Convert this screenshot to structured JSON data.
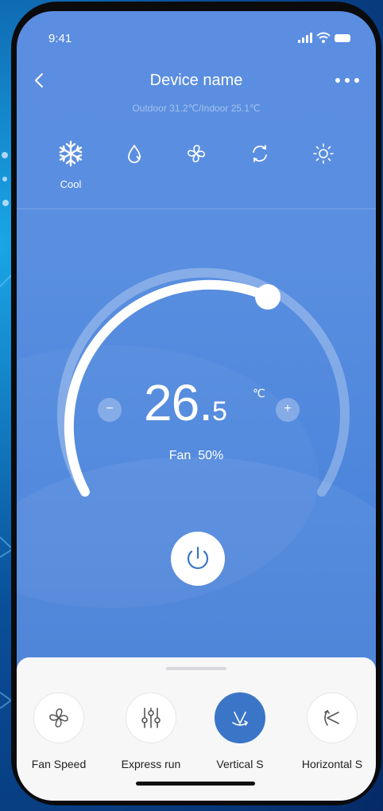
{
  "status": {
    "time": "9:41"
  },
  "header": {
    "title": "Device name",
    "subtitle": "Outdoor 31.2℃/Indoor 25.1℃"
  },
  "modes": [
    {
      "icon": "snowflake-icon",
      "label": "Cool",
      "selected": true
    },
    {
      "icon": "droplet-icon",
      "label": ""
    },
    {
      "icon": "fan-icon",
      "label": ""
    },
    {
      "icon": "auto-cycle-icon",
      "label": ""
    },
    {
      "icon": "sun-icon",
      "label": ""
    }
  ],
  "thermostat": {
    "temp_int": "26.",
    "temp_dec": "5",
    "unit": "℃",
    "fan_label": "Fan",
    "fan_value": "50%",
    "minus": "−",
    "plus": "+"
  },
  "functions": [
    {
      "label": "Fan Speed",
      "icon": "fan-speed-icon",
      "active": false
    },
    {
      "label": "Express run",
      "icon": "sliders-icon",
      "active": false
    },
    {
      "label": "Vertical S",
      "icon": "vertical-swing-icon",
      "active": true
    },
    {
      "label": "Horizontal S",
      "icon": "horizontal-swing-icon",
      "active": false
    }
  ],
  "colors": {
    "accent": "#3a75c8",
    "screen_top": "#5b8de0",
    "sheet": "#f7f7f8"
  }
}
